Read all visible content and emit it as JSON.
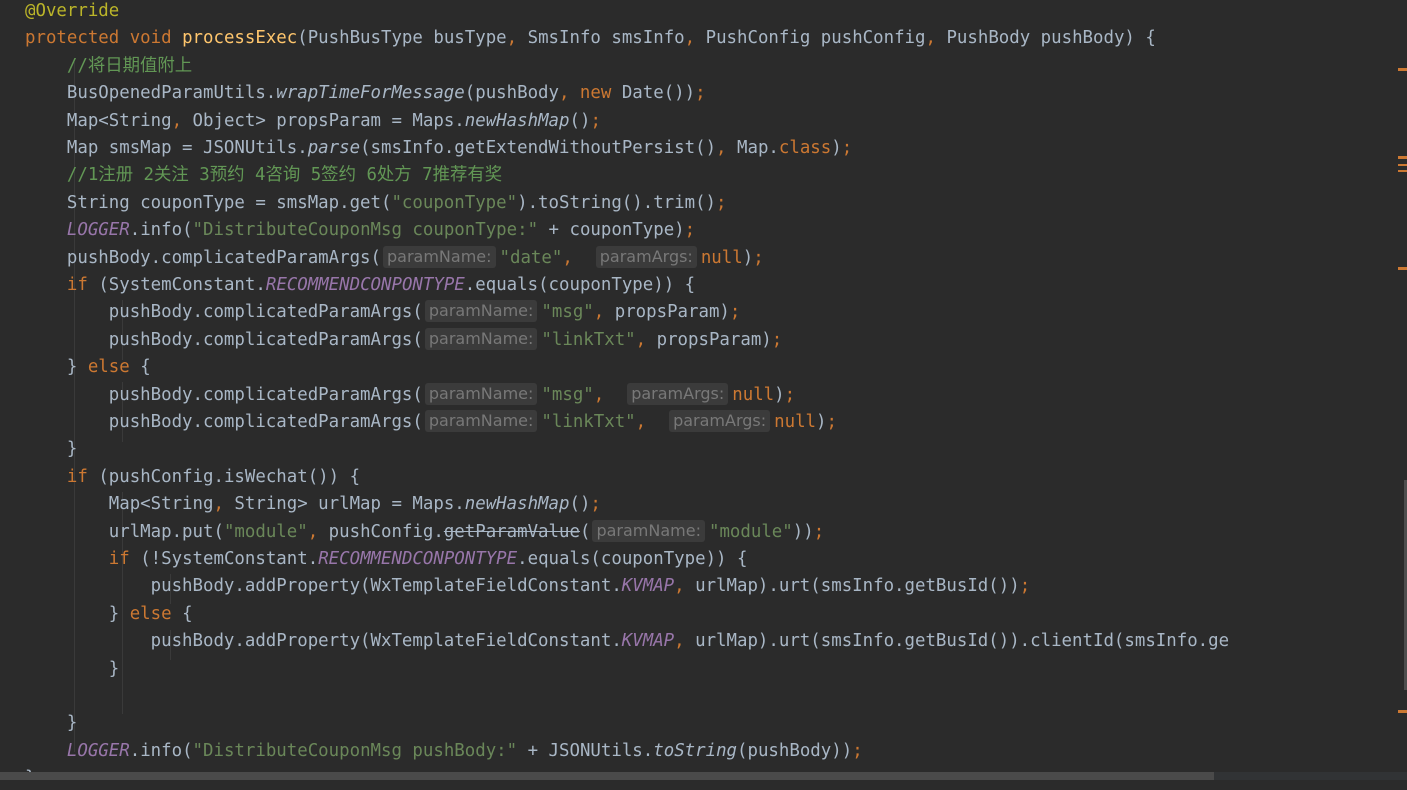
{
  "editor": {
    "lines": [
      [
        {
          "t": "@Override",
          "c": "ann"
        }
      ],
      [
        {
          "t": "protected void ",
          "c": "kw"
        },
        {
          "t": "processExec",
          "c": "fn"
        },
        {
          "t": "(PushBusType busType"
        },
        {
          "t": ", ",
          "c": "kw"
        },
        {
          "t": "SmsInfo smsInfo"
        },
        {
          "t": ", ",
          "c": "kw"
        },
        {
          "t": "PushConfig pushConfig"
        },
        {
          "t": ", ",
          "c": "kw"
        },
        {
          "t": "PushBody pushBody) {"
        }
      ],
      [
        {
          "t": "    "
        },
        {
          "t": "//将日期值附上",
          "c": "cm"
        }
      ],
      [
        {
          "t": "    BusOpenedParamUtils."
        },
        {
          "t": "wrapTimeForMessage",
          "c": "sm"
        },
        {
          "t": "(pushBody"
        },
        {
          "t": ", new ",
          "c": "kw"
        },
        {
          "t": "Date())"
        },
        {
          "t": ";",
          "c": "kw"
        }
      ],
      [
        {
          "t": "    Map<String"
        },
        {
          "t": ", ",
          "c": "kw"
        },
        {
          "t": "Object> propsParam = Maps."
        },
        {
          "t": "newHashMap",
          "c": "sm"
        },
        {
          "t": "()"
        },
        {
          "t": ";",
          "c": "kw"
        }
      ],
      [
        {
          "t": "    Map smsMap = JSONUtils."
        },
        {
          "t": "parse",
          "c": "sm"
        },
        {
          "t": "(smsInfo.getExtendWithoutPersist()"
        },
        {
          "t": ", ",
          "c": "kw"
        },
        {
          "t": "Map."
        },
        {
          "t": "class",
          "c": "kw"
        },
        {
          "t": ")"
        },
        {
          "t": ";",
          "c": "kw"
        }
      ],
      [
        {
          "t": "    "
        },
        {
          "t": "//1注册 2关注 3预约 4咨询 5签约 6处方 7推荐有奖",
          "c": "cm"
        }
      ],
      [
        {
          "t": "    String couponType = smsMap.get("
        },
        {
          "t": "\"couponType\"",
          "c": "str"
        },
        {
          "t": ").toString().trim()"
        },
        {
          "t": ";",
          "c": "kw"
        }
      ],
      [
        {
          "t": "    "
        },
        {
          "t": "LOGGER",
          "c": "st"
        },
        {
          "t": ".info("
        },
        {
          "t": "\"DistributeCouponMsg couponType:\"",
          "c": "str"
        },
        {
          "t": " + couponType)"
        },
        {
          "t": ";",
          "c": "kw"
        }
      ],
      [
        {
          "t": "    pushBody.complicatedParamArgs("
        },
        {
          "h": "paramName:"
        },
        {
          "t": "\"date\"",
          "c": "str"
        },
        {
          "t": ",  ",
          "c": "kw"
        },
        {
          "h": "paramArgs:"
        },
        {
          "t": "null",
          "c": "kw"
        },
        {
          "t": ")"
        },
        {
          "t": ";",
          "c": "kw"
        }
      ],
      [
        {
          "t": "    "
        },
        {
          "t": "if ",
          "c": "kw"
        },
        {
          "t": "(SystemConstant."
        },
        {
          "t": "RECOMMENDCONPONTYPE",
          "c": "st"
        },
        {
          "t": ".equals(couponType)) {"
        }
      ],
      [
        {
          "t": "        pushBody.complicatedParamArgs("
        },
        {
          "h": "paramName:"
        },
        {
          "t": "\"msg\"",
          "c": "str"
        },
        {
          "t": ", ",
          "c": "kw"
        },
        {
          "t": "propsParam)"
        },
        {
          "t": ";",
          "c": "kw"
        }
      ],
      [
        {
          "t": "        pushBody.complicatedParamArgs("
        },
        {
          "h": "paramName:"
        },
        {
          "t": "\"linkTxt\"",
          "c": "str"
        },
        {
          "t": ", ",
          "c": "kw"
        },
        {
          "t": "propsParam)"
        },
        {
          "t": ";",
          "c": "kw"
        }
      ],
      [
        {
          "t": "    } "
        },
        {
          "t": "else ",
          "c": "kw"
        },
        {
          "t": "{"
        }
      ],
      [
        {
          "t": "        pushBody.complicatedParamArgs("
        },
        {
          "h": "paramName:"
        },
        {
          "t": "\"msg\"",
          "c": "str"
        },
        {
          "t": ",  ",
          "c": "kw"
        },
        {
          "h": "paramArgs:"
        },
        {
          "t": "null",
          "c": "kw"
        },
        {
          "t": ")"
        },
        {
          "t": ";",
          "c": "kw"
        }
      ],
      [
        {
          "t": "        pushBody.complicatedParamArgs("
        },
        {
          "h": "paramName:"
        },
        {
          "t": "\"linkTxt\"",
          "c": "str"
        },
        {
          "t": ",  ",
          "c": "kw"
        },
        {
          "h": "paramArgs:"
        },
        {
          "t": "null",
          "c": "kw"
        },
        {
          "t": ")"
        },
        {
          "t": ";",
          "c": "kw"
        }
      ],
      [
        {
          "t": "    }"
        }
      ],
      [
        {
          "t": "    "
        },
        {
          "t": "if ",
          "c": "kw"
        },
        {
          "t": "(pushConfig.isWechat()) {"
        }
      ],
      [
        {
          "t": "        Map<String"
        },
        {
          "t": ", ",
          "c": "kw"
        },
        {
          "t": "String> urlMap = Maps."
        },
        {
          "t": "newHashMap",
          "c": "sm"
        },
        {
          "t": "()"
        },
        {
          "t": ";",
          "c": "kw"
        }
      ],
      [
        {
          "t": "        urlMap.put("
        },
        {
          "t": "\"module\"",
          "c": "str"
        },
        {
          "t": ", ",
          "c": "kw"
        },
        {
          "t": "pushConfig."
        },
        {
          "t": "getParamValue",
          "c": "dep"
        },
        {
          "t": "("
        },
        {
          "h": "paramName:"
        },
        {
          "t": "\"module\"",
          "c": "str"
        },
        {
          "t": "))"
        },
        {
          "t": ";",
          "c": "kw"
        }
      ],
      [
        {
          "t": "        "
        },
        {
          "t": "if ",
          "c": "kw"
        },
        {
          "t": "(!SystemConstant."
        },
        {
          "t": "RECOMMENDCONPONTYPE",
          "c": "st"
        },
        {
          "t": ".equals(couponType)) {"
        }
      ],
      [
        {
          "t": "            pushBody.addProperty(WxTemplateFieldConstant."
        },
        {
          "t": "KVMAP",
          "c": "st"
        },
        {
          "t": ", ",
          "c": "kw"
        },
        {
          "t": "urlMap).urt(smsInfo.getBusId())"
        },
        {
          "t": ";",
          "c": "kw"
        }
      ],
      [
        {
          "t": "        } "
        },
        {
          "t": "else ",
          "c": "kw"
        },
        {
          "t": "{"
        }
      ],
      [
        {
          "t": "            pushBody.addProperty(WxTemplateFieldConstant."
        },
        {
          "t": "KVMAP",
          "c": "st"
        },
        {
          "t": ", ",
          "c": "kw"
        },
        {
          "t": "urlMap).urt(smsInfo.getBusId()).clientId(smsInfo.ge"
        }
      ],
      [
        {
          "t": "        }"
        }
      ],
      [],
      [
        {
          "t": "    }"
        }
      ],
      [
        {
          "t": "    "
        },
        {
          "t": "LOGGER",
          "c": "st"
        },
        {
          "t": ".info("
        },
        {
          "t": "\"DistributeCouponMsg pushBody:\"",
          "c": "str"
        },
        {
          "t": " + JSONUtils."
        },
        {
          "t": "toString",
          "c": "sm"
        },
        {
          "t": "(pushBody))"
        },
        {
          "t": ";",
          "c": "kw"
        }
      ],
      [
        {
          "t": "}"
        }
      ]
    ]
  },
  "colors": {
    "background": "#2b2b2b",
    "keyword": "#cc7832",
    "annotation": "#bbb529",
    "method_declaration": "#ffc66d",
    "string": "#6a8759",
    "comment": "#629755",
    "static_field": "#9876aa",
    "plain": "#a9b7c6"
  }
}
